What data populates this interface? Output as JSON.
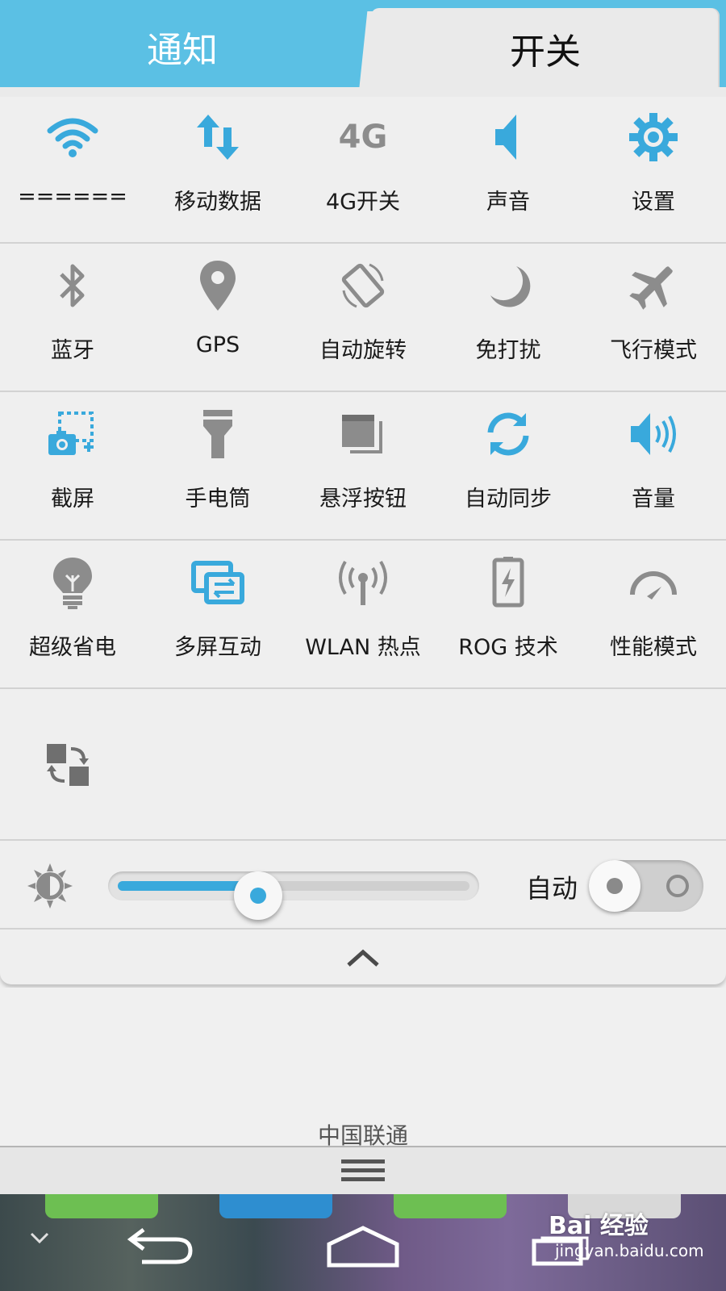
{
  "tabs": {
    "notify": "通知",
    "switches": "开关"
  },
  "grid": [
    [
      {
        "label": "======",
        "icon": "wifi-icon",
        "state": "on"
      },
      {
        "label": "移动数据",
        "icon": "mobile-data-icon",
        "state": "on"
      },
      {
        "label": "4G开关",
        "icon": "4g-icon",
        "state": "off"
      },
      {
        "label": "声音",
        "icon": "sound-icon",
        "state": "on"
      },
      {
        "label": "设置",
        "icon": "gear-icon",
        "state": "on"
      }
    ],
    [
      {
        "label": "蓝牙",
        "icon": "bluetooth-icon",
        "state": "off"
      },
      {
        "label": "GPS",
        "icon": "location-icon",
        "state": "off"
      },
      {
        "label": "自动旋转",
        "icon": "rotate-icon",
        "state": "off"
      },
      {
        "label": "免打扰",
        "icon": "moon-icon",
        "state": "off"
      },
      {
        "label": "飞行模式",
        "icon": "airplane-icon",
        "state": "off"
      }
    ],
    [
      {
        "label": "截屏",
        "icon": "screenshot-icon",
        "state": "on"
      },
      {
        "label": "手电筒",
        "icon": "flashlight-icon",
        "state": "off"
      },
      {
        "label": "悬浮按钮",
        "icon": "floating-button-icon",
        "state": "off"
      },
      {
        "label": "自动同步",
        "icon": "sync-icon",
        "state": "on"
      },
      {
        "label": "音量",
        "icon": "volume-icon",
        "state": "on"
      }
    ],
    [
      {
        "label": "超级省电",
        "icon": "bulb-icon",
        "state": "off"
      },
      {
        "label": "多屏互动",
        "icon": "multi-screen-icon",
        "state": "on"
      },
      {
        "label": "WLAN 热点",
        "icon": "hotspot-icon",
        "state": "off"
      },
      {
        "label": "ROG 技术",
        "icon": "battery-bolt-icon",
        "state": "off"
      },
      {
        "label": "性能模式",
        "icon": "speedometer-icon",
        "state": "off"
      }
    ]
  ],
  "edit_icon": "swap-tiles-icon",
  "brightness": {
    "icon": "brightness-icon",
    "level": 0.4,
    "auto_label": "自动",
    "auto_enabled": false
  },
  "collapse_icon": "chevron-up-icon",
  "carrier": "中国联通",
  "handle_icon": "menu-lines-icon",
  "navbar": {
    "back_icon": "back-icon",
    "home_icon": "home-icon",
    "recent_icon": "recent-apps-icon"
  },
  "watermark": {
    "logo": "Bai 经验",
    "url": "jingyan.baidu.com"
  },
  "colors": {
    "accent": "#39a9dc",
    "tab_bar": "#5bc0e4",
    "inactive_icon": "#8c8c8c"
  }
}
